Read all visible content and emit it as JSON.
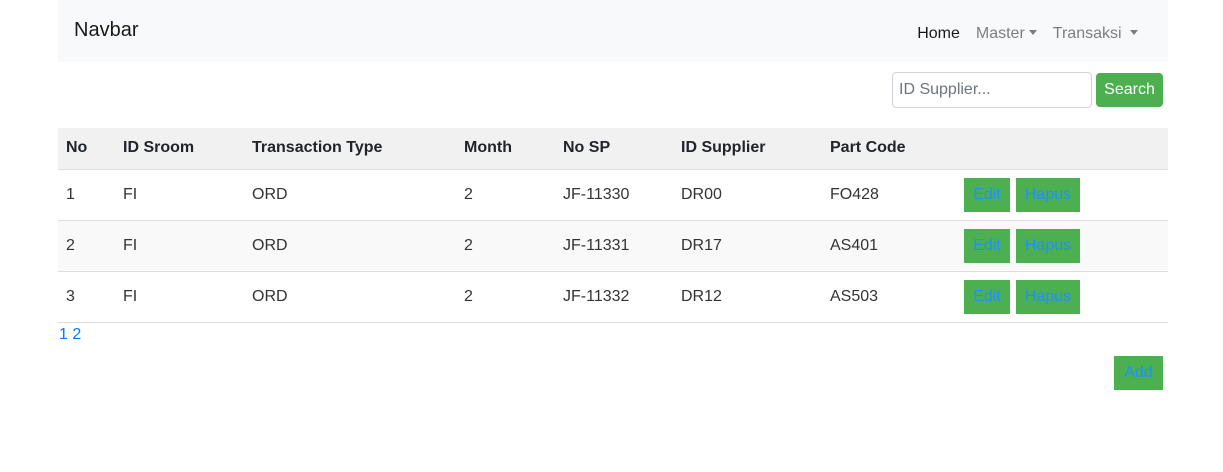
{
  "navbar": {
    "brand": "Navbar",
    "items": [
      {
        "label": "Home"
      },
      {
        "label": "Master"
      },
      {
        "label": "Transaksi"
      }
    ]
  },
  "search": {
    "placeholder": "ID Supplier...",
    "value": "",
    "button_label": "Search"
  },
  "table": {
    "headers": [
      "No",
      "ID Sroom",
      "Transaction Type",
      "Month",
      "No SP",
      "ID Supplier",
      "Part Code",
      ""
    ],
    "rows": [
      {
        "no": "1",
        "id_sroom": "FI",
        "type": "ORD",
        "month": "2",
        "no_sp": "JF-11330",
        "id_supplier": "DR00",
        "part_code": "FO428"
      },
      {
        "no": "2",
        "id_sroom": "FI",
        "type": "ORD",
        "month": "2",
        "no_sp": "JF-11331",
        "id_supplier": "DR17",
        "part_code": "AS401"
      },
      {
        "no": "3",
        "id_sroom": "FI",
        "type": "ORD",
        "month": "2",
        "no_sp": "JF-11332",
        "id_supplier": "DR12",
        "part_code": "AS503"
      }
    ],
    "edit_label": "Edit",
    "delete_label": "Hapus"
  },
  "pagination": {
    "pages": [
      "1",
      "2"
    ]
  },
  "add_label": "Add",
  "colors": {
    "accent_green": "#4caf50",
    "link_blue": "#007bff",
    "navbar_bg": "#f8f9fa"
  }
}
